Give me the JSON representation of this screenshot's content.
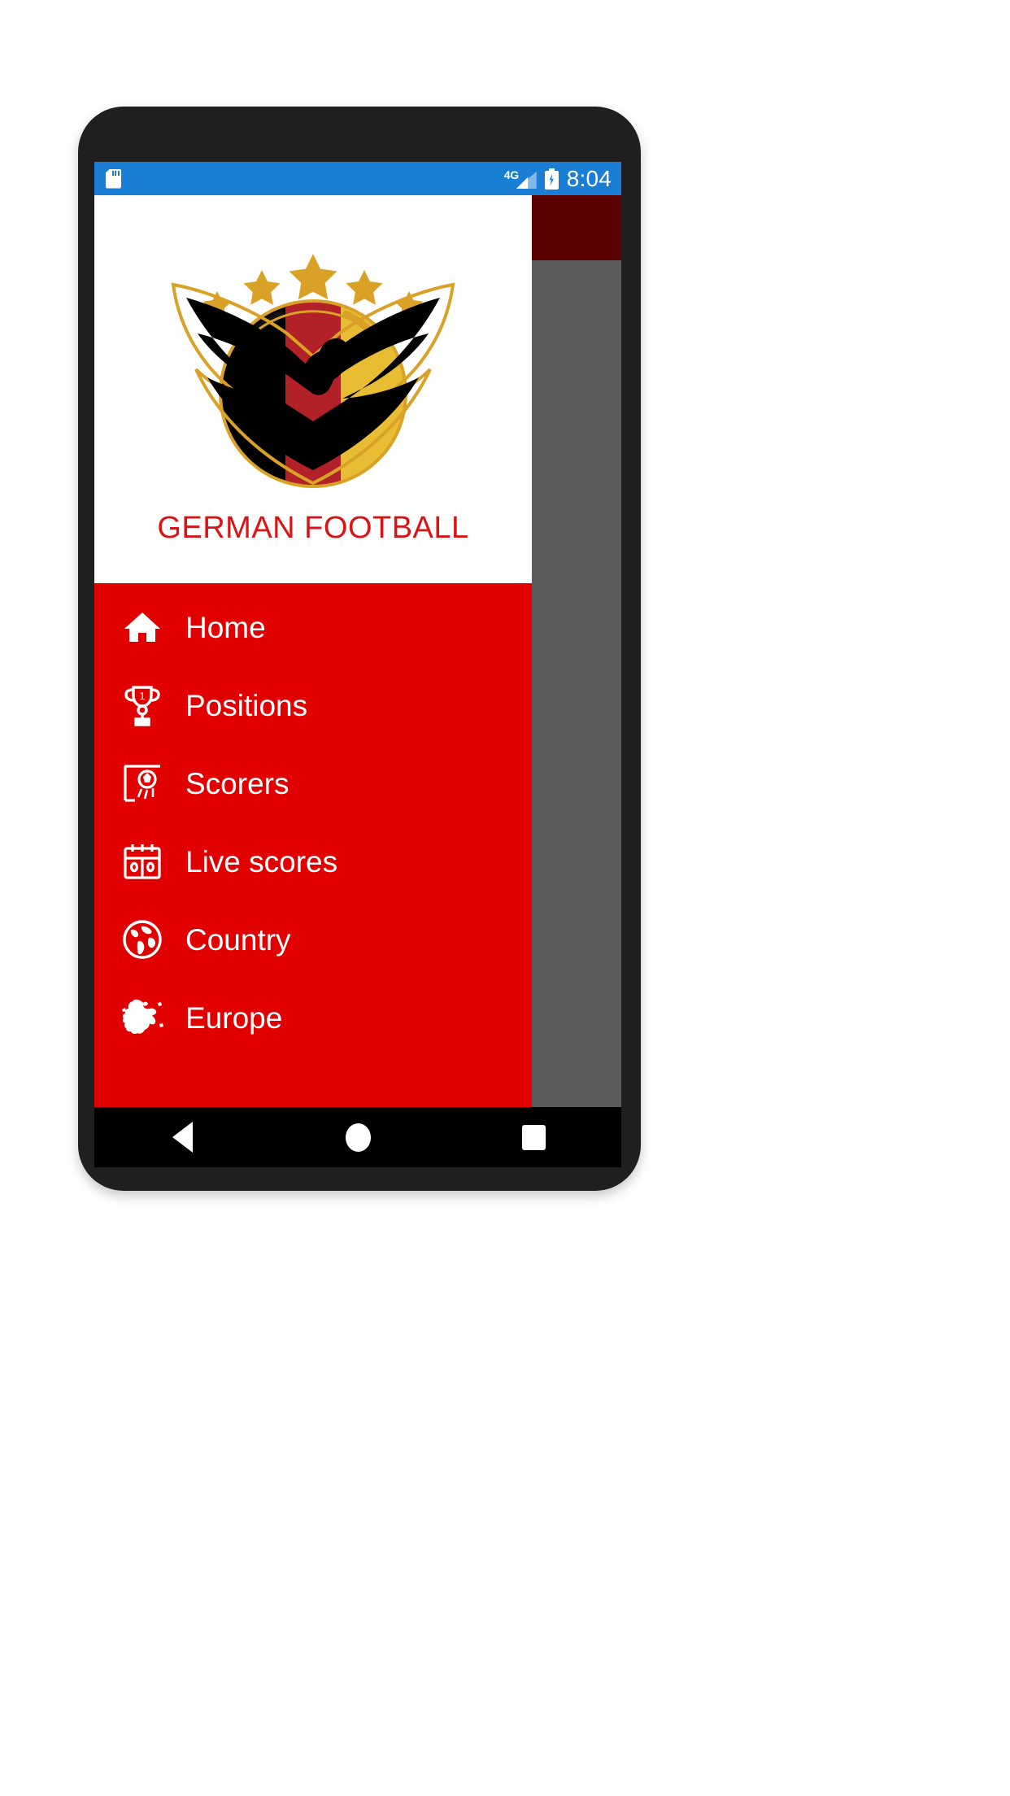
{
  "device": {
    "frame_color": "#1f1f1f"
  },
  "status_bar": {
    "background": "#1a7fd4",
    "sd_card_icon": "sd-card-icon",
    "network_label": "4G",
    "signal_icon": "signal-bars-icon",
    "battery_icon": "battery-charging-icon",
    "time": "8:04"
  },
  "app_bar_behind": {
    "background": "#5b0000"
  },
  "scrim": {
    "background": "#5b5b5b"
  },
  "drawer": {
    "background": "#e00000",
    "header": {
      "background": "#ffffff",
      "logo_name": "german-football-crest-logo",
      "logo_stars": 5,
      "logo_colors": {
        "gold": "#d9a227",
        "black": "#000000",
        "red": "#b22028",
        "yellow": "#e8bd33"
      },
      "title": "GERMAN FOOTBALL",
      "title_color": "#d81414"
    },
    "items": [
      {
        "icon": "home-icon",
        "label": "Home"
      },
      {
        "icon": "trophy-icon",
        "label": "Positions"
      },
      {
        "icon": "goal-net-icon",
        "label": "Scorers"
      },
      {
        "icon": "calendar-icon",
        "label": "Live scores"
      },
      {
        "icon": "globe-icon",
        "label": "Country"
      },
      {
        "icon": "europe-map-icon",
        "label": "Europe"
      }
    ]
  },
  "nav_bar": {
    "background": "#000000",
    "buttons": [
      {
        "name": "back-button",
        "icon": "triangle-left-icon"
      },
      {
        "name": "home-button",
        "icon": "circle-icon"
      },
      {
        "name": "recents-button",
        "icon": "square-icon"
      }
    ]
  }
}
